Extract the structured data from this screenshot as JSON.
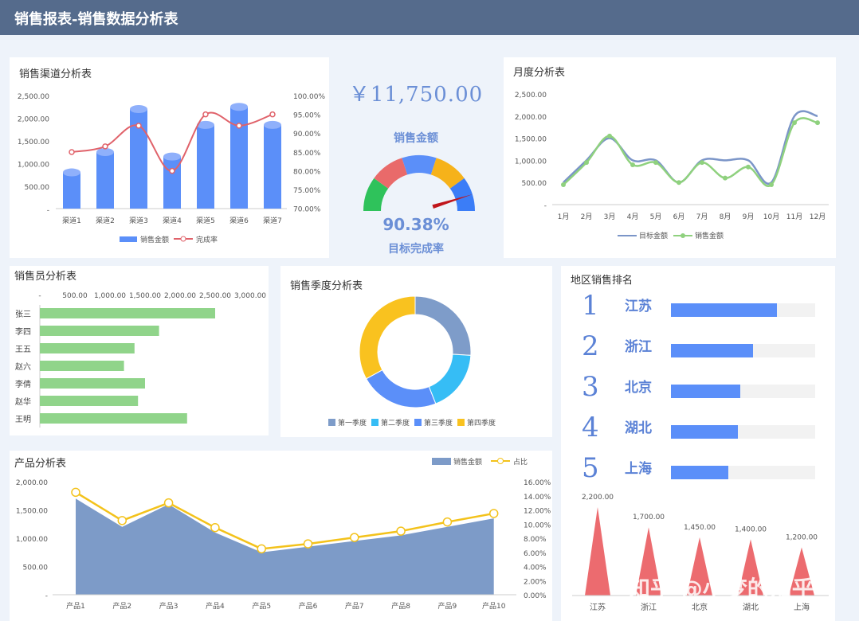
{
  "header": {
    "title": "销售报表-销售数据分析表"
  },
  "kpi": {
    "amount": "￥11,750.00",
    "amount_label": "销售金额",
    "rate": "90.38%",
    "rate_label": "目标完成率",
    "rate_value": 0.9038
  },
  "channel": {
    "title": "销售渠道分析表",
    "legend_bar": "销售金额",
    "legend_line": "完成率",
    "y_ticks": [
      "2,500.00",
      "2,000.00",
      "1,500.00",
      "1,000.00",
      "500.00",
      "-"
    ],
    "y2_ticks": [
      "100.00%",
      "95.00%",
      "90.00%",
      "85.00%",
      "80.00%",
      "75.00%",
      "70.00%"
    ]
  },
  "monthly": {
    "title": "月度分析表",
    "legend_target": "目标金额",
    "legend_sales": "销售金额",
    "y_ticks": [
      "2,500.00",
      "2,000.00",
      "1,500.00",
      "1,000.00",
      "500.00",
      "-"
    ]
  },
  "salesman": {
    "title": "销售员分析表",
    "x_ticks": [
      "-",
      "500.00",
      "1,000.00",
      "1,500.00",
      "2,000.00",
      "2,500.00",
      "3,000.00"
    ]
  },
  "season": {
    "title": "销售季度分析表"
  },
  "product": {
    "title": "产品分析表",
    "legend_area": "销售金额",
    "legend_line": "占比",
    "y_ticks": [
      "2,000.00",
      "1,500.00",
      "1,000.00",
      "500.00",
      "-"
    ],
    "y2_ticks": [
      "16.00%",
      "14.00%",
      "12.00%",
      "10.00%",
      "8.00%",
      "6.00%",
      "4.00%",
      "2.00%",
      "0.00%"
    ]
  },
  "region": {
    "title": "地区销售排名",
    "ranks": [
      {
        "num": "1",
        "name": "江苏",
        "value": 2200
      },
      {
        "num": "2",
        "name": "浙江",
        "value": 1700
      },
      {
        "num": "3",
        "name": "北京",
        "value": 1450
      },
      {
        "num": "4",
        "name": "湖北",
        "value": 1400
      },
      {
        "num": "5",
        "name": "上海",
        "value": 1200
      }
    ]
  },
  "watermark": "知乎 @小梦的知乎",
  "chart_data": [
    {
      "type": "bar",
      "title": "销售渠道分析表",
      "categories": [
        "渠道1",
        "渠道2",
        "渠道3",
        "渠道4",
        "渠道5",
        "渠道6",
        "渠道7"
      ],
      "series": [
        {
          "name": "销售金额",
          "values": [
            800,
            1250,
            2200,
            1150,
            1850,
            2250,
            1850
          ]
        },
        {
          "name": "完成率",
          "values": [
            0.85,
            0.865,
            0.92,
            0.8,
            0.95,
            0.92,
            0.95
          ]
        }
      ],
      "ylim": [
        0,
        2500
      ],
      "y2lim": [
        0.7,
        1.0
      ]
    },
    {
      "type": "line",
      "title": "月度分析表",
      "categories": [
        "1月",
        "2月",
        "3月",
        "4月",
        "5月",
        "6月",
        "7月",
        "8月",
        "9月",
        "10月",
        "11月",
        "12月"
      ],
      "series": [
        {
          "name": "目标金额",
          "values": [
            500,
            1000,
            1500,
            1000,
            1000,
            500,
            1000,
            1000,
            1000,
            500,
            2000,
            2000
          ]
        },
        {
          "name": "销售金额",
          "values": [
            450,
            950,
            1550,
            900,
            950,
            500,
            950,
            600,
            850,
            450,
            1850,
            1850
          ]
        }
      ],
      "ylim": [
        0,
        2500
      ]
    },
    {
      "type": "bar",
      "title": "销售员分析表",
      "categories": [
        "张三",
        "李四",
        "王五",
        "赵六",
        "李倩",
        "赵华",
        "王明"
      ],
      "values": [
        2500,
        1700,
        1350,
        1200,
        1500,
        1400,
        2100
      ],
      "xlim": [
        0,
        3000
      ]
    },
    {
      "type": "pie",
      "title": "销售季度分析表",
      "categories": [
        "第一季度",
        "第二季度",
        "第三季度",
        "第四季度"
      ],
      "values": [
        26,
        18,
        23,
        33
      ]
    },
    {
      "type": "area",
      "title": "产品分析表",
      "categories": [
        "产品1",
        "产品2",
        "产品3",
        "产品4",
        "产品5",
        "产品6",
        "产品7",
        "产品8",
        "产品9",
        "产品10"
      ],
      "series": [
        {
          "name": "销售金额",
          "values": [
            1700,
            1200,
            1600,
            1100,
            750,
            850,
            950,
            1050,
            1200,
            1350
          ]
        },
        {
          "name": "占比",
          "values": [
            0.145,
            0.105,
            0.13,
            0.095,
            0.065,
            0.072,
            0.081,
            0.09,
            0.103,
            0.115
          ]
        }
      ],
      "ylim": [
        0,
        2000
      ],
      "y2lim": [
        0,
        0.16
      ]
    },
    {
      "type": "bar",
      "title": "地区销售排名",
      "categories": [
        "江苏",
        "浙江",
        "北京",
        "湖北",
        "上海"
      ],
      "values": [
        2200,
        1700,
        1450,
        1400,
        1200
      ],
      "labels": [
        "2,200.00",
        "1,700.00",
        "1,450.00",
        "1,400.00",
        "1,200.00"
      ]
    }
  ]
}
